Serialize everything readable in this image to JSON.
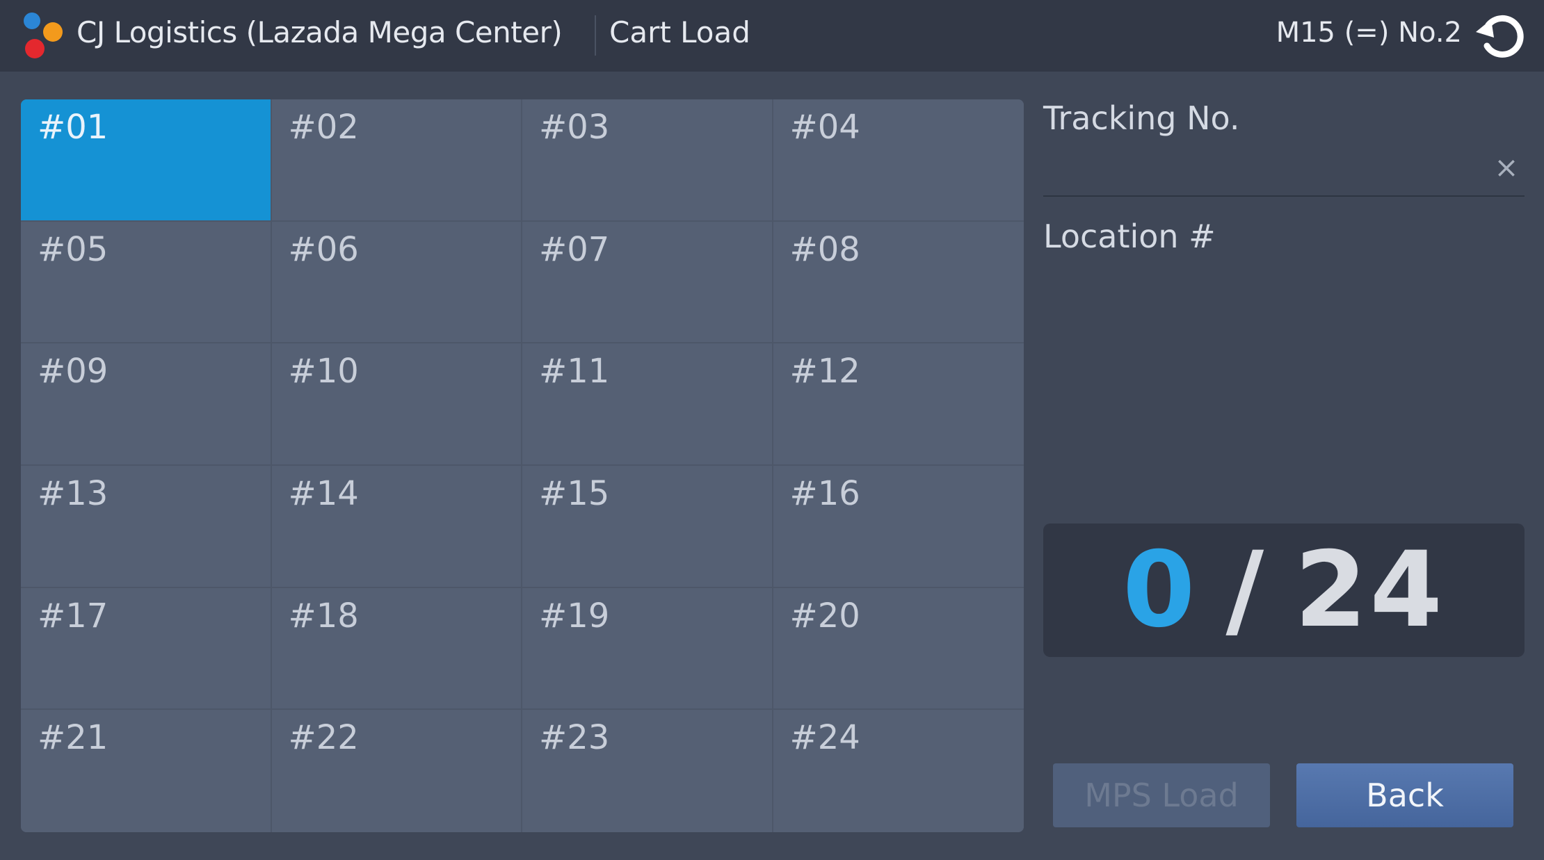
{
  "header": {
    "title": "CJ Logistics (Lazada Mega Center)",
    "subtitle": "Cart Load",
    "status": "M15 (=) No.2",
    "refresh_icon": "refresh-icon"
  },
  "grid": {
    "cells": [
      {
        "label": "#01",
        "active": true
      },
      {
        "label": "#02"
      },
      {
        "label": "#03"
      },
      {
        "label": "#04"
      },
      {
        "label": "#05"
      },
      {
        "label": "#06"
      },
      {
        "label": "#07"
      },
      {
        "label": "#08"
      },
      {
        "label": "#09"
      },
      {
        "label": "#10"
      },
      {
        "label": "#11"
      },
      {
        "label": "#12"
      },
      {
        "label": "#13"
      },
      {
        "label": "#14"
      },
      {
        "label": "#15"
      },
      {
        "label": "#16"
      },
      {
        "label": "#17"
      },
      {
        "label": "#18"
      },
      {
        "label": "#19"
      },
      {
        "label": "#20"
      },
      {
        "label": "#21"
      },
      {
        "label": "#22"
      },
      {
        "label": "#23"
      },
      {
        "label": "#24"
      }
    ]
  },
  "panel": {
    "tracking_label": "Tracking No.",
    "tracking_value": "",
    "clear_icon": "×",
    "location_label": "Location #",
    "counter": {
      "current": "0",
      "separator": "/",
      "total": "24"
    },
    "mps_load_label": "MPS Load",
    "back_label": "Back"
  },
  "colors": {
    "accent": "#1592d4",
    "counter_current": "#2aa3e6",
    "background": "#3f4757",
    "header": "#323846"
  }
}
